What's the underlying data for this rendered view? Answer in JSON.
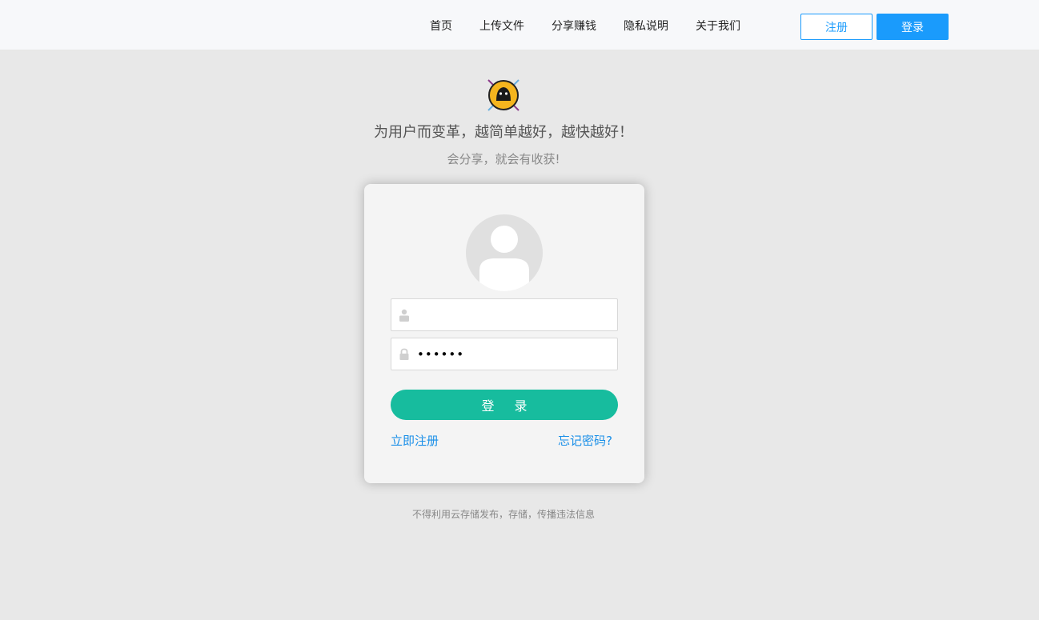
{
  "nav": {
    "items": [
      "首页",
      "上传文件",
      "分享赚钱",
      "隐私说明",
      "关于我们"
    ],
    "register_label": "注册",
    "login_label": "登录"
  },
  "hero": {
    "slogan": "为用户而变革，越简单越好，越快越好！",
    "subtitle": "会分享，就会有收获!"
  },
  "login_form": {
    "username_value": "",
    "password_value": "••••••",
    "submit_label": "登 录",
    "register_link": "立即注册",
    "forgot_link": "忘记密码?",
    "icons": [
      "user-icon",
      "lock-icon"
    ]
  },
  "footer": {
    "notice": "不得利用云存储发布，存储，传播违法信息"
  },
  "colors": {
    "accent": "#1a9bfc",
    "submit": "#17bc9e",
    "link": "#1a8fe8"
  }
}
